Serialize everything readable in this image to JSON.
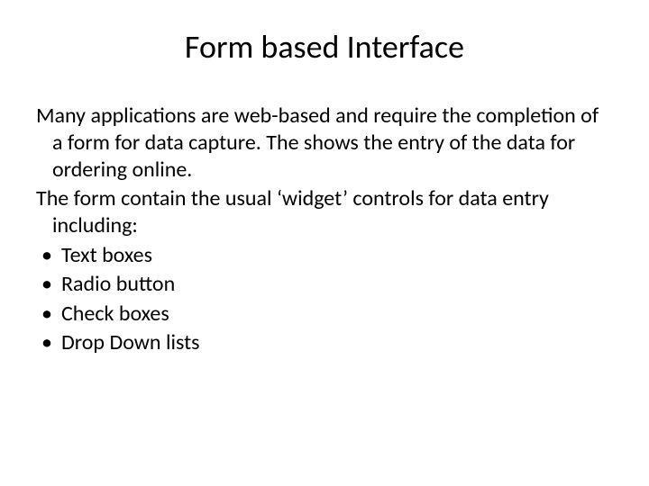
{
  "title": "Form based Interface",
  "paragraphs": [
    "Many applications are web-based and require the completion of a form for data capture. The shows the entry of the data for ordering online.",
    "The form contain the usual ‘widget’ controls for data entry including:"
  ],
  "bullets": [
    "Text boxes",
    "Radio button",
    "Check boxes",
    "Drop Down lists"
  ]
}
